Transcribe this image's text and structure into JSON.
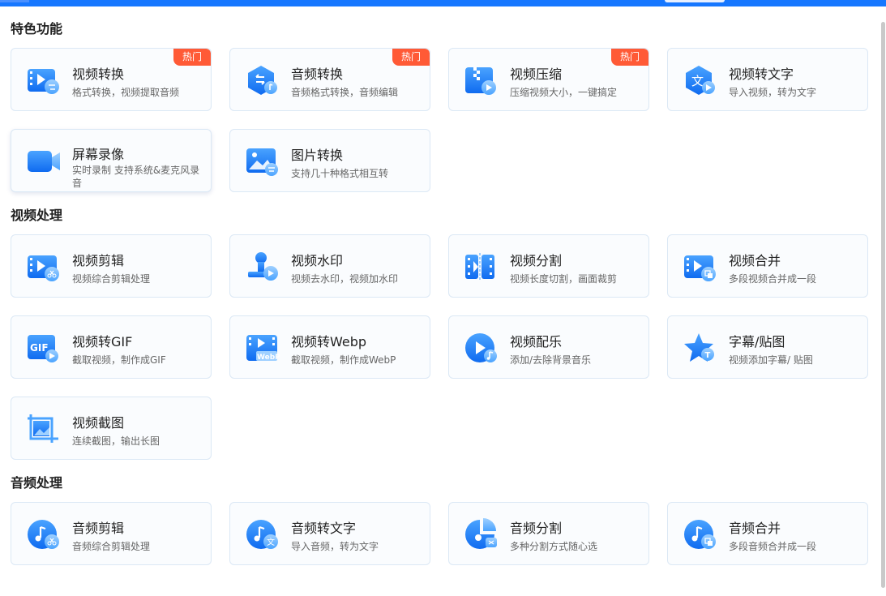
{
  "sections": {
    "featured": "特色功能",
    "video": "视频处理",
    "audio": "音频处理"
  },
  "hot_badge": "热门",
  "cards": {
    "video_convert": {
      "title": "视频转换",
      "desc": "格式转换，视频提取音频"
    },
    "audio_convert": {
      "title": "音频转换",
      "desc": "音频格式转换，音频编辑"
    },
    "video_compress": {
      "title": "视频压缩",
      "desc": "压缩视频大小，一键搞定"
    },
    "video_to_text": {
      "title": "视频转文字",
      "desc": "导入视频，转为文字"
    },
    "screen_record": {
      "title": "屏幕录像",
      "desc": "实时录制 支持系统&麦克风录音"
    },
    "image_convert": {
      "title": "图片转换",
      "desc": "支持几十种格式相互转"
    },
    "video_edit": {
      "title": "视频剪辑",
      "desc": "视频综合剪辑处理"
    },
    "video_watermark": {
      "title": "视频水印",
      "desc": "视频去水印，视频加水印"
    },
    "video_split": {
      "title": "视频分割",
      "desc": "视频长度切割，画面裁剪"
    },
    "video_merge": {
      "title": "视频合并",
      "desc": "多段视频合并成一段"
    },
    "video_to_gif": {
      "title": "视频转GIF",
      "desc": "截取视频，制作成GIF"
    },
    "video_to_webp": {
      "title": "视频转Webp",
      "desc": "截取视频，制作成WebP"
    },
    "video_music": {
      "title": "视频配乐",
      "desc": "添加/去除背景音乐"
    },
    "subtitle_sticker": {
      "title": "字幕/贴图",
      "desc": "视频添加字幕/ 贴图"
    },
    "video_screenshot": {
      "title": "视频截图",
      "desc": "连续截图，输出长图"
    },
    "audio_edit": {
      "title": "音频剪辑",
      "desc": "音频综合剪辑处理"
    },
    "audio_to_text": {
      "title": "音频转文字",
      "desc": "导入音频，转为文字"
    },
    "audio_split": {
      "title": "音频分割",
      "desc": "多种分割方式随心选"
    },
    "audio_merge": {
      "title": "音频合并",
      "desc": "多段音频合并成一段"
    }
  },
  "icon_labels": {
    "gif": "GIF",
    "webp": "WebP",
    "text": "文",
    "sticker": "T"
  },
  "colors": {
    "accent": "#1677ff",
    "badge": "#ff5a36",
    "icon_light": "#63b3ff"
  }
}
